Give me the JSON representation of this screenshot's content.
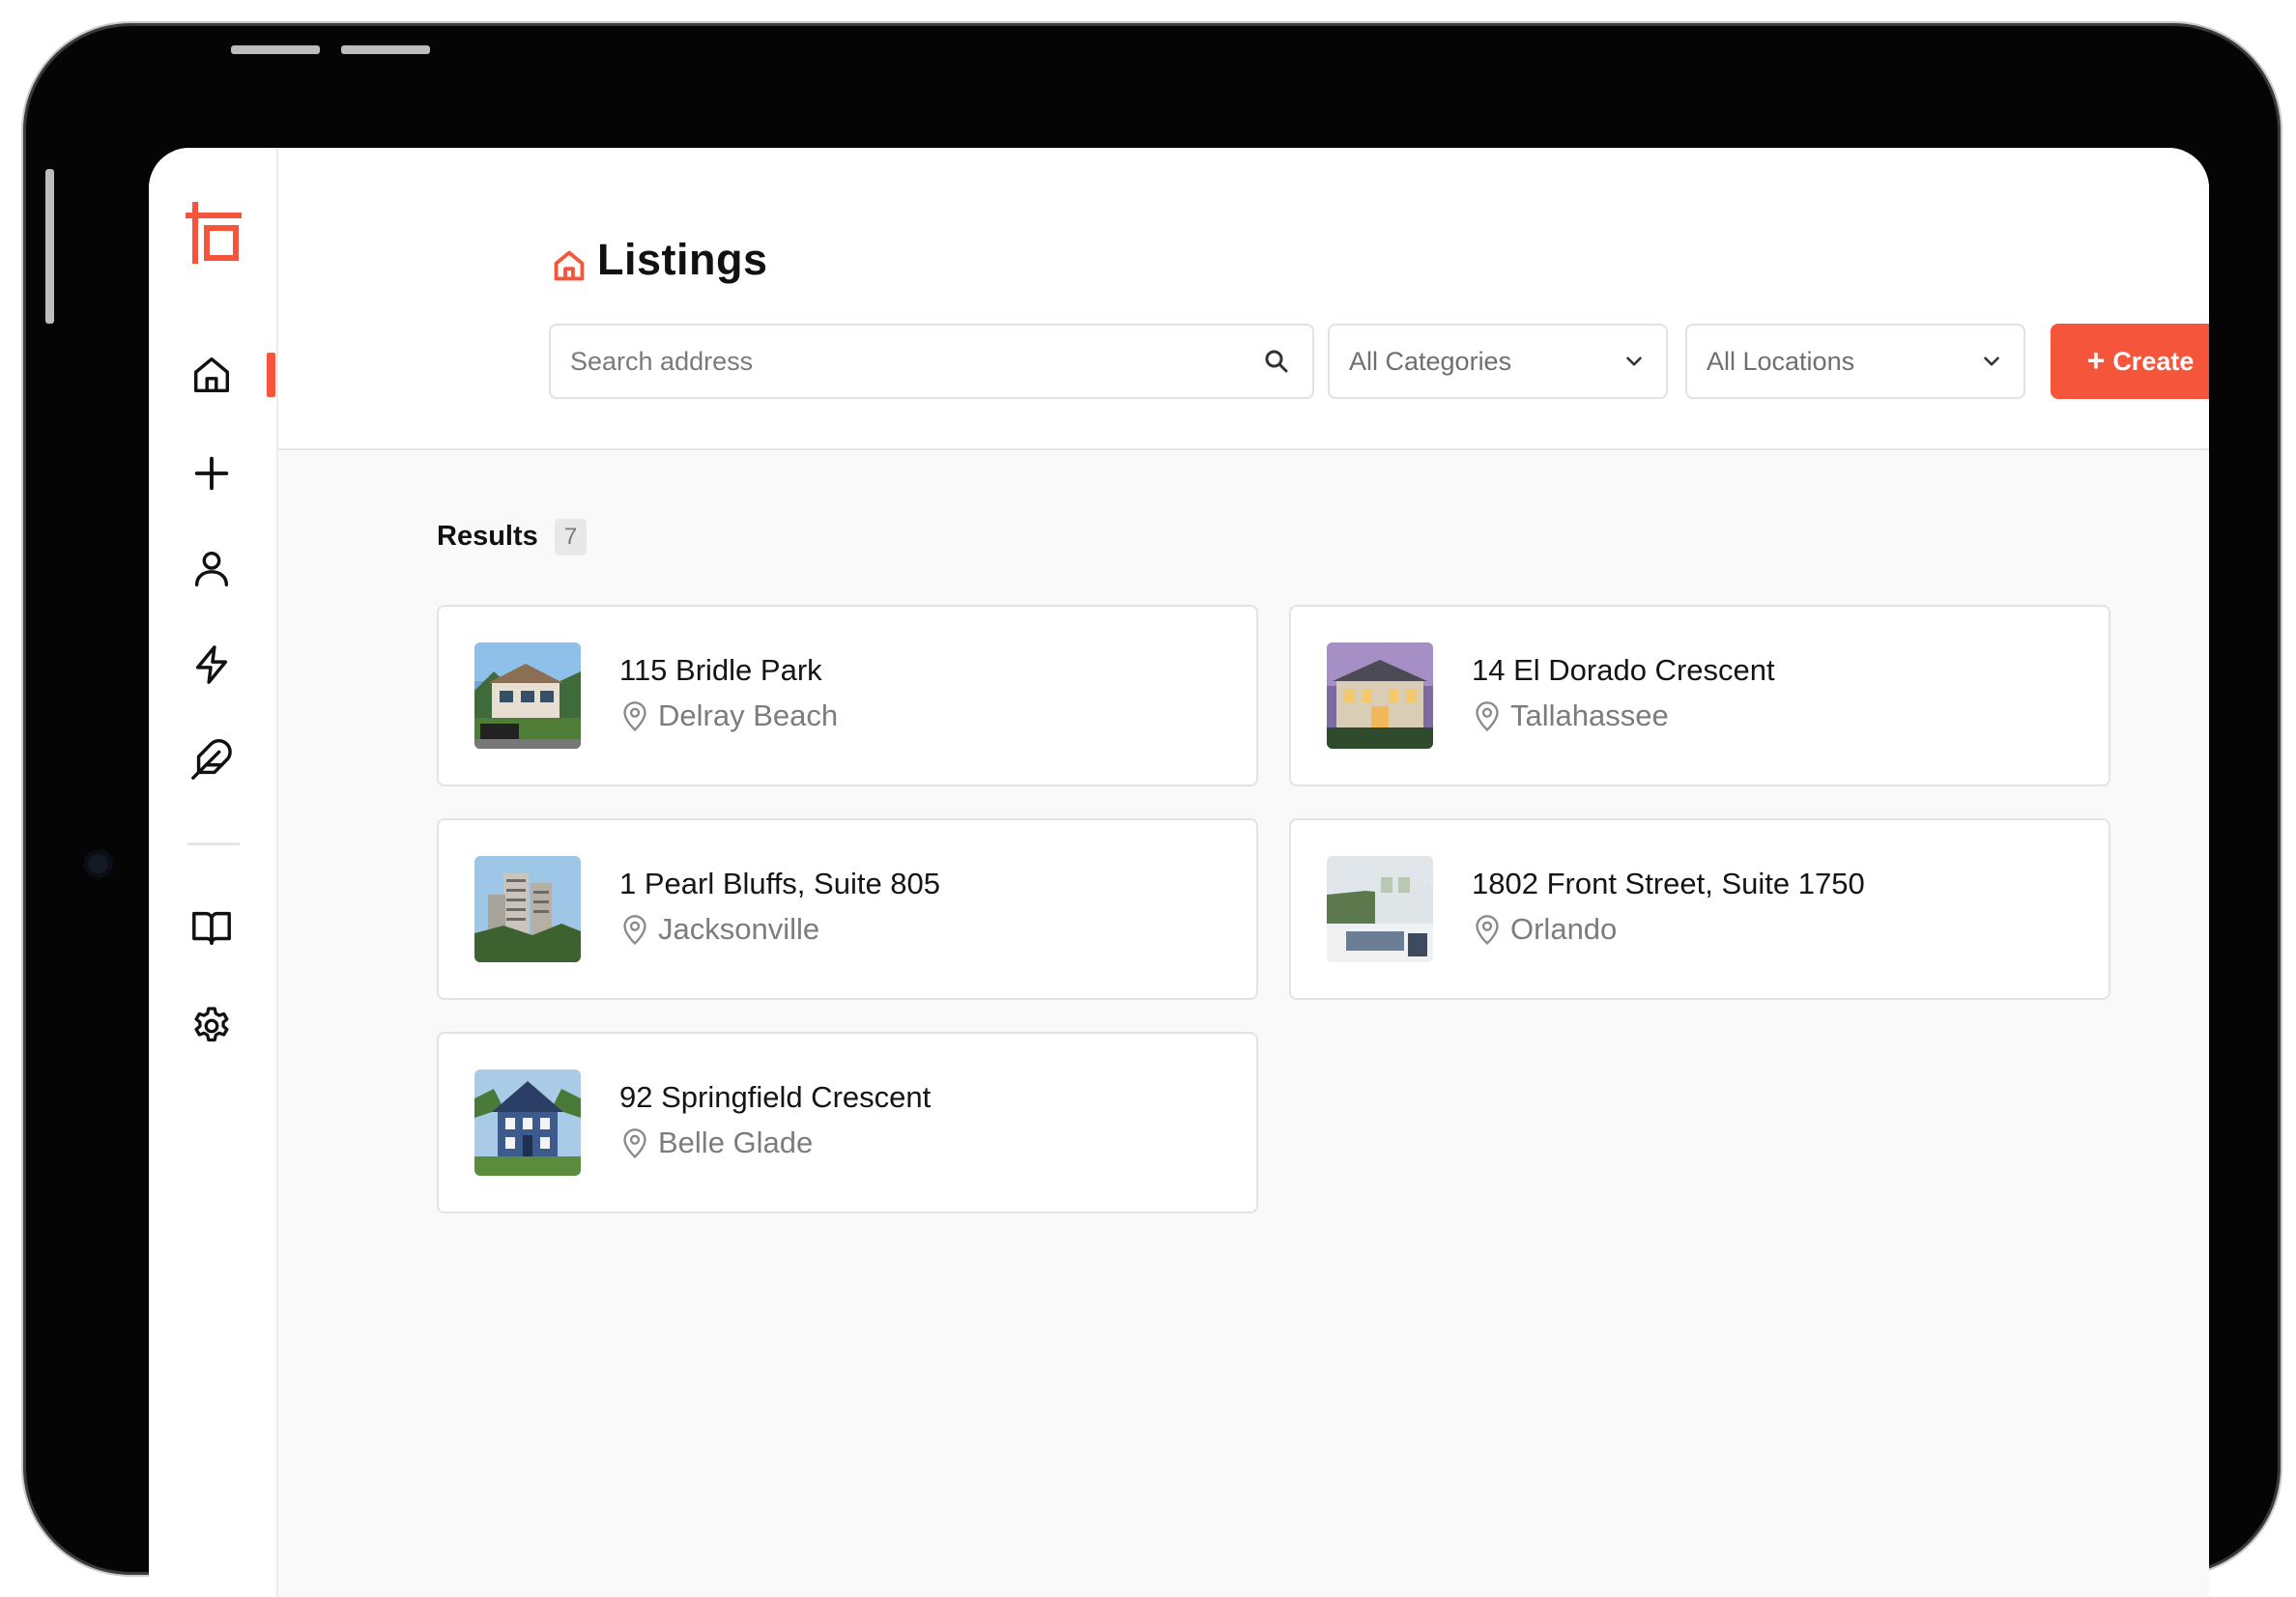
{
  "nav": {
    "items": [
      {
        "id": "home",
        "icon": "home-icon",
        "active": true
      },
      {
        "id": "add",
        "icon": "plus-icon",
        "active": false
      },
      {
        "id": "profile",
        "icon": "user-icon",
        "active": false
      },
      {
        "id": "activity",
        "icon": "lightning-icon",
        "active": false
      },
      {
        "id": "feather",
        "icon": "feather-icon",
        "active": false
      },
      {
        "id": "docs",
        "icon": "book-icon",
        "active": false
      },
      {
        "id": "settings",
        "icon": "gear-icon",
        "active": false
      }
    ]
  },
  "header": {
    "title": "Listings",
    "title_icon": "home-icon",
    "search_placeholder": "Search address",
    "category_filter": "All Categories",
    "location_filter": "All Locations",
    "create_label": "Create",
    "create_icon": "+"
  },
  "results": {
    "label": "Results",
    "count": "7"
  },
  "listings": [
    {
      "address": "115 Bridle Park",
      "city": "Delray Beach",
      "thumb": "modern-house-photo"
    },
    {
      "address": "14 El Dorado Crescent",
      "city": "Tallahassee",
      "thumb": "mansion-dusk-photo"
    },
    {
      "address": "1 Pearl Bluffs, Suite 805",
      "city": "Jacksonville",
      "thumb": "tower-blocks-photo"
    },
    {
      "address": "1802 Front Street, Suite 1750",
      "city": "Orlando",
      "thumb": "rooftop-terrace-photo"
    },
    {
      "address": "92 Springfield Crescent",
      "city": "Belle Glade",
      "thumb": "blue-house-photo"
    }
  ],
  "colors": {
    "accent": "#f5553a",
    "background": "#f9f9f9",
    "card_border": "#e3e3e3"
  }
}
